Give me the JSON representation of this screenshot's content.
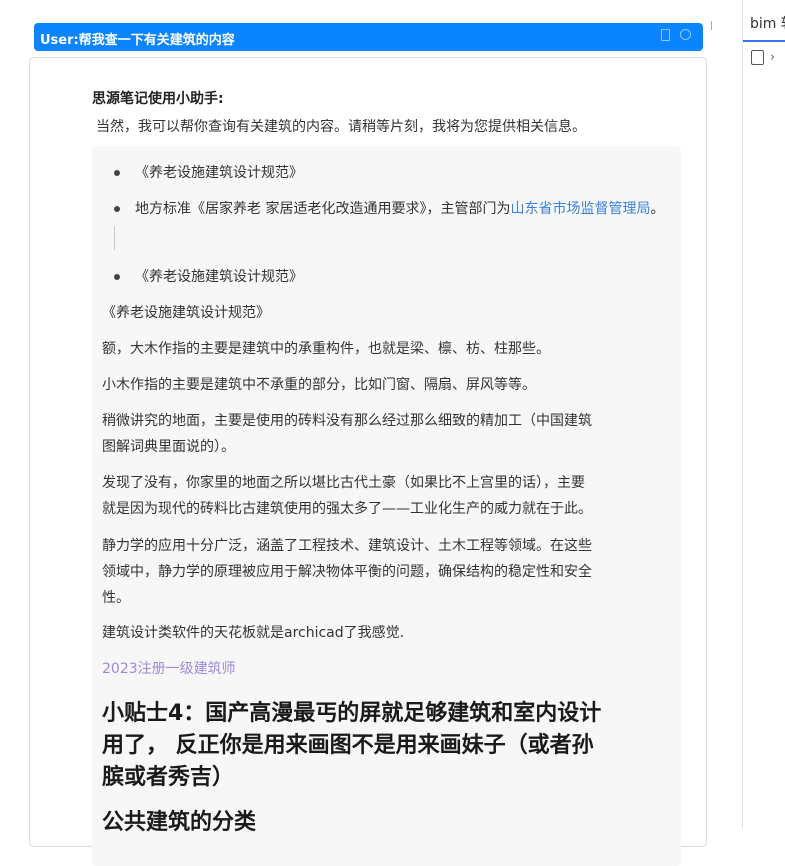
{
  "user_bar": {
    "text": "User:帮我查一下有关建筑的内容"
  },
  "right_panel": {
    "tab_label": "bim 软"
  },
  "assistant": {
    "name": "思源笔记使用小助手:",
    "intro": "当然，我可以帮你查询有关建筑的内容。请稍等片刻，我将为您提供相关信息。"
  },
  "list_items": [
    {
      "text": "《养老设施建筑设计规范》"
    },
    {
      "prefix": "地方标准《居家养老 家居适老化改造通用要求》，主管部门为",
      "link": "山东省市场监督管理局",
      "suffix": "。"
    },
    {
      "text": "《养老设施建筑设计规范》"
    }
  ],
  "paragraphs": {
    "p1": "《养老设施建筑设计规范》",
    "p2": "额，大木作指的主要是建筑中的承重构件，也就是梁、檩、枋、柱那些。",
    "p3": "小木作指的主要是建筑中不承重的部分，比如门窗、隔扇、屏风等等。",
    "p4a": "稍微讲究的地面，主要是使用的砖料没有那么经过那么细致的精加工（中国建筑",
    "p4b": "图解词典里面说的）。",
    "p5a": "发现了没有，你家里的地面之所以堪比古代土豪（如果比不上宫里的话），主要",
    "p5b": "就是因为现代的砖料比古建筑使用的强太多了——工业化生产的威力就在于此。",
    "p6a": "静力学的应用十分广泛，涵盖了工程技术、建筑设计、土木工程等领域。在这些",
    "p6b": "领域中，静力学的原理被应用于解决物体平衡的问题，确保结构的稳定性和安全",
    "p6c": "性。",
    "p7": "建筑设计类软件的天花板就是archicad了我感觉.",
    "p8": "2023注册一级建筑师"
  },
  "headings": {
    "h1a": "小贴士4：国产高漫最丐的屏就足够建筑和室内设计",
    "h1b": "用了， 反正你是用来画图不是用来画妹子（或者孙",
    "h1c": "膑或者秀吉）",
    "h2": "公共建筑的分类"
  },
  "colors": {
    "user_bar": "#0a84ff",
    "link": "#3b82d6",
    "purple": "#a187d7"
  }
}
